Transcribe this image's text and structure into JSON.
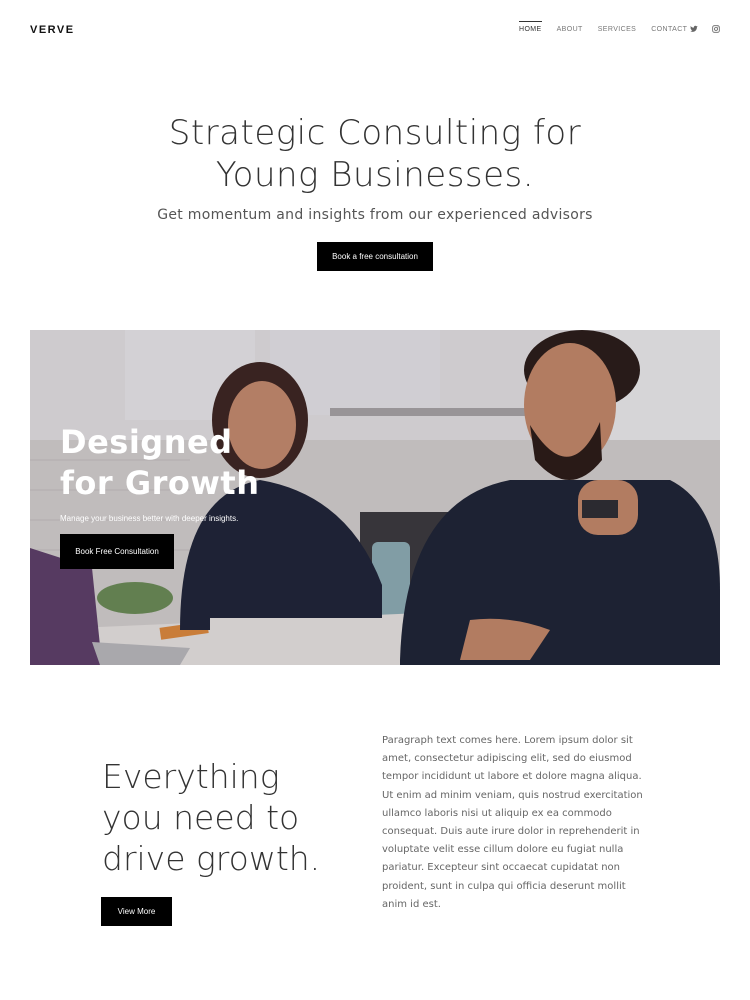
{
  "header": {
    "logo": "VERVE",
    "nav": [
      "HOME",
      "ABOUT",
      "SERVICES",
      "CONTACT"
    ],
    "active_nav": "HOME",
    "social_icons": [
      "twitter-icon",
      "instagram-icon"
    ]
  },
  "hero": {
    "title_line1": "Strategic Consulting for",
    "title_line2": "Young Businesses.",
    "subtitle": "Get momentum and insights from our experienced advisors",
    "button": "Book a free consultation"
  },
  "banner": {
    "title_line1": "Designed",
    "title_line2": "for Growth",
    "subtitle": "Manage your business better with deeper insights.",
    "button": "Book Free Consultation"
  },
  "features": {
    "title_line1": "Everything",
    "title_line2": "you need to",
    "title_line3": "drive growth.",
    "button": "View More",
    "paragraph": "Paragraph text comes here. Lorem ipsum dolor sit amet, consectetur adipiscing elit, sed do eiusmod tempor incididunt ut labore et dolore magna aliqua. Ut enim ad minim veniam, quis nostrud exercitation ullamco laboris nisi ut aliquip ex ea commodo consequat. Duis aute irure dolor in reprehenderit in voluptate velit esse cillum dolore eu fugiat nulla pariatur. Excepteur sint occaecat cupidatat non proident, sunt in culpa qui officia deserunt mollit anim id est."
  },
  "colors": {
    "button_bg": "#000000",
    "button_text": "#ffffff",
    "text_dark": "#333333",
    "text_muted": "#666666"
  }
}
